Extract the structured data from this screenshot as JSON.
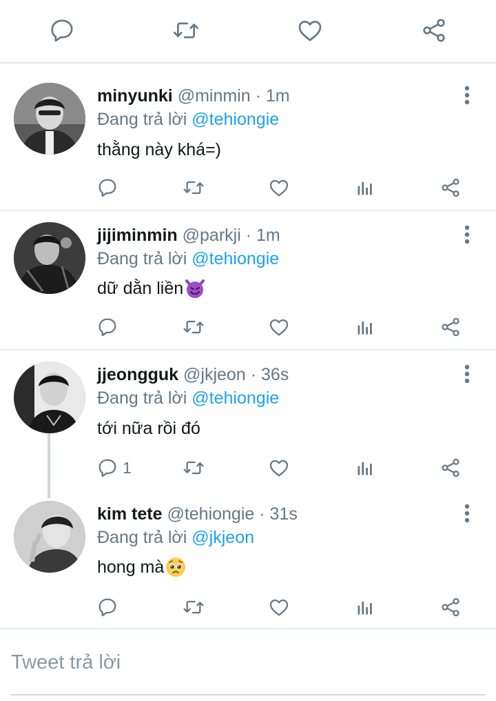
{
  "top_actions": [
    "reply-icon",
    "retweet-icon",
    "like-icon",
    "share-icon"
  ],
  "icon_color": "#657786",
  "link_color": "#1da1f2",
  "tweets": [
    {
      "name": "minyunki",
      "handle": "@minmin",
      "time": "1m",
      "reply_prefix": "Đang trả lời",
      "reply_to": "@tehiongie",
      "text": "thằng này khá=)",
      "emoji": "",
      "reply_count": ""
    },
    {
      "name": "jijiminmin",
      "handle": "@parkji",
      "time": "1m",
      "reply_prefix": "Đang trả lời",
      "reply_to": "@tehiongie",
      "text": "dữ dằn liền",
      "emoji": "smiling-devil-emoji",
      "reply_count": ""
    },
    {
      "name": "jjeongguk",
      "handle": "@jkjeon",
      "time": "36s",
      "reply_prefix": "Đang trả lời",
      "reply_to": "@tehiongie",
      "text": "tới nữa rồi đó",
      "emoji": "",
      "reply_count": "1"
    },
    {
      "name": "kim tete",
      "handle": "@tehiongie",
      "time": "31s",
      "reply_prefix": "Đang trả lời",
      "reply_to": "@jkjeon",
      "text": "hong mà",
      "emoji": "pleading-face-emoji",
      "reply_count": ""
    }
  ],
  "reply_box": {
    "placeholder": "Tweet trả lời"
  }
}
